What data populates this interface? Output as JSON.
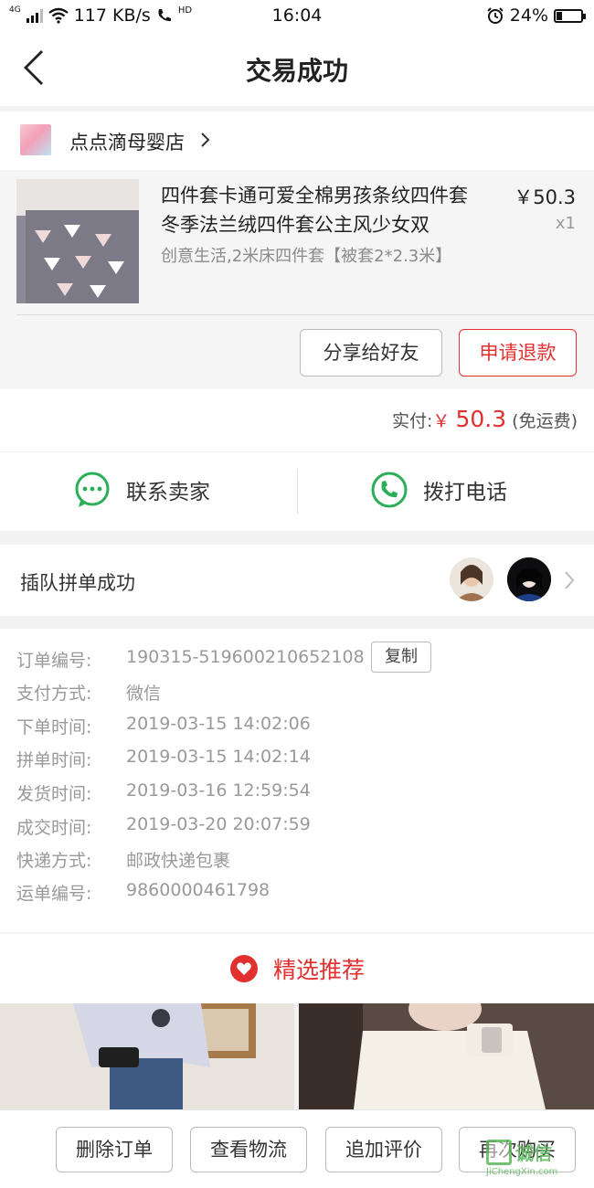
{
  "status_bar": {
    "net_type": "4G",
    "speed": "117 KB/s",
    "hd": "HD",
    "time": "16:04",
    "battery": "24%"
  },
  "header": {
    "title": "交易成功"
  },
  "store": {
    "name": "点点滴母婴店"
  },
  "product": {
    "title_line1": "四件套卡通可爱全棉男孩条纹四件套",
    "title_line2": "冬季法兰绒四件套公主风少女双",
    "spec": "创意生活,2米床四件套【被套2*2.3米】",
    "price": "￥50.3",
    "quantity": "x1"
  },
  "actions": {
    "share": "分享给好友",
    "refund": "申请退款"
  },
  "payment": {
    "label": "实付:",
    "currency": "￥",
    "amount": "50.3",
    "shipping": "(免运费)"
  },
  "contact": {
    "seller": "联系卖家",
    "phone": "拨打电话"
  },
  "group": {
    "label": "插队拼单成功"
  },
  "order_info": {
    "copy": "复制",
    "rows": [
      {
        "k": "订单编号:",
        "v": "190315-519600210652108"
      },
      {
        "k": "支付方式:",
        "v": "微信"
      },
      {
        "k": "下单时间:",
        "v": "2019-03-15 14:02:06"
      },
      {
        "k": "拼单时间:",
        "v": "2019-03-15 14:02:14"
      },
      {
        "k": "发货时间:",
        "v": "2019-03-16 12:59:54"
      },
      {
        "k": "成交时间:",
        "v": "2019-03-20 20:07:59"
      },
      {
        "k": "快递方式:",
        "v": "邮政快递包裹"
      },
      {
        "k": "运单编号:",
        "v": "9860000461798"
      }
    ]
  },
  "recommend": {
    "title": "精选推荐"
  },
  "bottom_bar": {
    "delete": "删除订单",
    "logistics": "查看物流",
    "review": "追加评价",
    "rebuy": "再次购买"
  },
  "watermark": {
    "brand": "诚信",
    "url": "JiChengXin.com"
  },
  "colors": {
    "accent": "#e0302f",
    "green": "#2aae57"
  }
}
